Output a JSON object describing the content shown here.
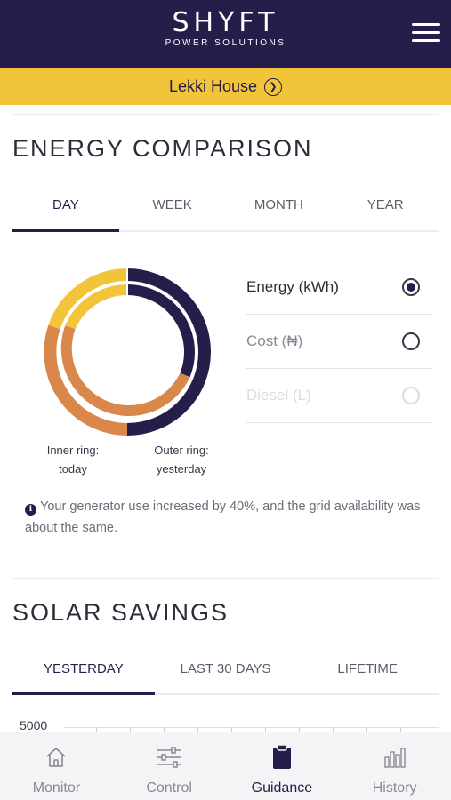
{
  "header": {
    "logo_main": "SHYFT",
    "logo_sub": "POWER SOLUTIONS",
    "menu_icon": "hamburger-menu-icon"
  },
  "location": {
    "name": "Lekki House",
    "arrow_icon": "chevron-right-circle-icon"
  },
  "energy_comparison": {
    "title": "ENERGY COMPARISON",
    "tabs": [
      {
        "label": "DAY",
        "active": true
      },
      {
        "label": "WEEK",
        "active": false
      },
      {
        "label": "MONTH",
        "active": false
      },
      {
        "label": "YEAR",
        "active": false
      }
    ],
    "inner_caption": "Inner ring:\ntoday",
    "outer_caption": "Outer ring:\nyesterday",
    "options": [
      {
        "label": "Energy (kWh)",
        "selected": true,
        "disabled": false
      },
      {
        "label": "Cost (₦)",
        "selected": false,
        "disabled": false
      },
      {
        "label": "Diesel (L)",
        "selected": false,
        "disabled": true
      }
    ],
    "note": "Your generator use increased by 40%, and the grid availability was about the same.",
    "colors": {
      "navy": "#251d4a",
      "orange": "#d9874a",
      "yellow": "#f2c43a"
    }
  },
  "solar_savings": {
    "title": "SOLAR SAVINGS",
    "tabs": [
      {
        "label": "YESTERDAY",
        "active": true
      },
      {
        "label": "LAST 30 DAYS",
        "active": false
      },
      {
        "label": "LIFETIME",
        "active": false
      }
    ],
    "y_axis_top": "5000"
  },
  "bottom_nav": [
    {
      "label": "Monitor",
      "icon": "home-icon",
      "active": false
    },
    {
      "label": "Control",
      "icon": "sliders-icon",
      "active": false
    },
    {
      "label": "Guidance",
      "icon": "clipboard-icon",
      "active": true
    },
    {
      "label": "History",
      "icon": "bar-chart-icon",
      "active": false
    }
  ]
}
